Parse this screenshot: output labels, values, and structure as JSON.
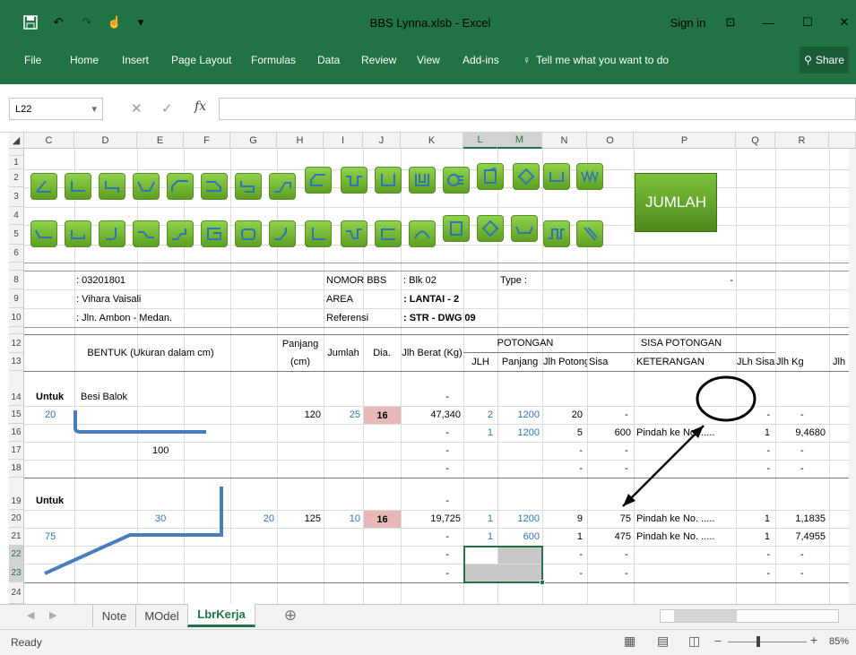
{
  "window": {
    "title": "BBS Lynna.xlsb - Excel",
    "sign_in": "Sign in",
    "share": "Share"
  },
  "menu": [
    "File",
    "Home",
    "Insert",
    "Page Layout",
    "Formulas",
    "Data",
    "Review",
    "View",
    "Add-ins"
  ],
  "tell_me": "Tell me what you want to do",
  "formula_bar": {
    "name_box": "L22",
    "formula": ""
  },
  "columns": [
    "C",
    "D",
    "E",
    "F",
    "G",
    "H",
    "I",
    "J",
    "K",
    "L",
    "M",
    "N",
    "O",
    "P",
    "Q",
    "R"
  ],
  "rows": [
    "1",
    "2",
    "3",
    "4",
    "5",
    "6",
    "8",
    "9",
    "10",
    "12",
    "13",
    "14",
    "15",
    "16",
    "17",
    "18",
    "19",
    "20",
    "21",
    "22",
    "23",
    "24"
  ],
  "jumlah_button": "JUMLAH",
  "info": {
    "nomor": ": 03201801",
    "vihara": ": Vihara Vaisali",
    "jln": ": Jln. Ambon - Medan.",
    "nomor_bbs_label": "NOMOR BBS",
    "area_label": "AREA",
    "referensi_label": "Referensi",
    "blk": ": Blk 02",
    "lantai": ": LANTAI - 2",
    "str": ": STR - DWG 09",
    "type_label": "Type :",
    "dash": "-"
  },
  "headers": {
    "bentuk": "BENTUK (Ukuran dalam cm)",
    "panjang": "Panjang",
    "cm": "(cm)",
    "jumlah": "Jumlah",
    "dia": "Dia.",
    "jlh_berat": "Jlh Berat (Kg)",
    "potongan": "POTONGAN",
    "sisa_potongan": "SISA POTONGAN",
    "jlh": "JLH",
    "panjang2": "Panjang",
    "jlh_potong": "Jlh Potong",
    "sisa": "Sisa",
    "keterangan": "KETERANGAN",
    "jlh_sisa": "JLh Sisa",
    "jlh_kg": "Jlh Kg",
    "jlh_trunc": "Jlh"
  },
  "body": {
    "untuk1": "Untuk",
    "besi_balok": "Besi Balok",
    "v20": "20",
    "v100": "100",
    "r14_k": "-",
    "r15": {
      "h": "120",
      "i": "25",
      "j": "16",
      "k": "47,340",
      "l": "2",
      "m": "1200",
      "n": "20",
      "o": "-",
      "q": "-",
      "r": "-"
    },
    "r16": {
      "k": "-",
      "l": "1",
      "m": "1200",
      "n": "5",
      "o": "600",
      "p": "Pindah ke No. .....",
      "q": "1",
      "r": "9,4680"
    },
    "r17": {
      "k": "-",
      "n": "-",
      "o": "-",
      "q": "-",
      "r": "-"
    },
    "r18": {
      "k": "-",
      "n": "-",
      "o": "-",
      "q": "-",
      "r": "-"
    },
    "untuk2": "Untuk",
    "v30": "30",
    "v20b": "20",
    "v75": "75",
    "r19_k": "-",
    "r20": {
      "h": "125",
      "i": "10",
      "j": "16",
      "k": "19,725",
      "l": "1",
      "m": "1200",
      "n": "9",
      "o": "75",
      "p": "Pindah ke No. .....",
      "q": "1",
      "r": "1,1835"
    },
    "r21": {
      "k": "-",
      "l": "1",
      "m": "600",
      "n": "1",
      "o": "475",
      "p": "Pindah ke No. .....",
      "q": "1",
      "r": "7,4955"
    },
    "r22": {
      "k": "-",
      "n": "-",
      "o": "-",
      "q": "-",
      "r": "-"
    },
    "r23": {
      "k": "-",
      "n": "-",
      "o": "-",
      "q": "-",
      "r": "-"
    }
  },
  "sheets": [
    "Note",
    "MOdel",
    "LbrKerja"
  ],
  "status": {
    "ready": "Ready",
    "zoom": "85%"
  },
  "colors": {
    "excel_green": "#217346",
    "button_green": "#6cb33f",
    "dia_fill": "#e6b8b7",
    "annotation": "#2e75b6"
  }
}
